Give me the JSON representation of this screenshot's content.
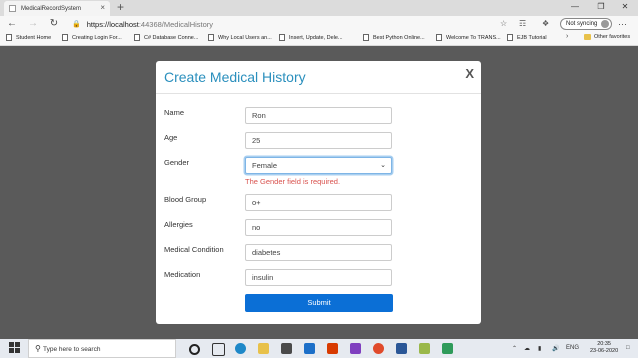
{
  "browser": {
    "tab_title": "MedicalRecordSystem",
    "tab_close": "×",
    "new_tab": "+",
    "url_host": "https://localhost",
    "url_path": ":44368/MedicalHistory",
    "sync_label": "Not syncing",
    "menu": "···",
    "bookmarks": [
      "Student Home",
      "Creating Login For...",
      "C# Database Conne...",
      "Why Local Users an...",
      "Insert, Update, Dele...",
      "Best Python Online...",
      "Welcome To TRANS...",
      "EJB Tutorial"
    ],
    "other_favorites": "Other favorites"
  },
  "modal": {
    "title": "Create Medical History",
    "close": "X",
    "fields": [
      {
        "label": "Name",
        "value": "Ron"
      },
      {
        "label": "Age",
        "value": "25"
      },
      {
        "label": "Gender",
        "value": "Female"
      },
      {
        "label": "Blood Group",
        "value": "o+"
      },
      {
        "label": "Allergies",
        "value": "no"
      },
      {
        "label": "Medical Condition",
        "value": "diabetes"
      },
      {
        "label": "Medication",
        "value": "insulin"
      }
    ],
    "gender_error": "The Gender field is required.",
    "submit_label": "Submit"
  },
  "taskbar": {
    "search_placeholder": "Type here to search",
    "language": "ENG",
    "time": "20:35",
    "date": "23-06-2020"
  },
  "colors": {
    "accent": "#2a8fbd",
    "submit": "#0b6fd6",
    "error": "#d9534f",
    "backdrop": "#5a5a5a"
  }
}
